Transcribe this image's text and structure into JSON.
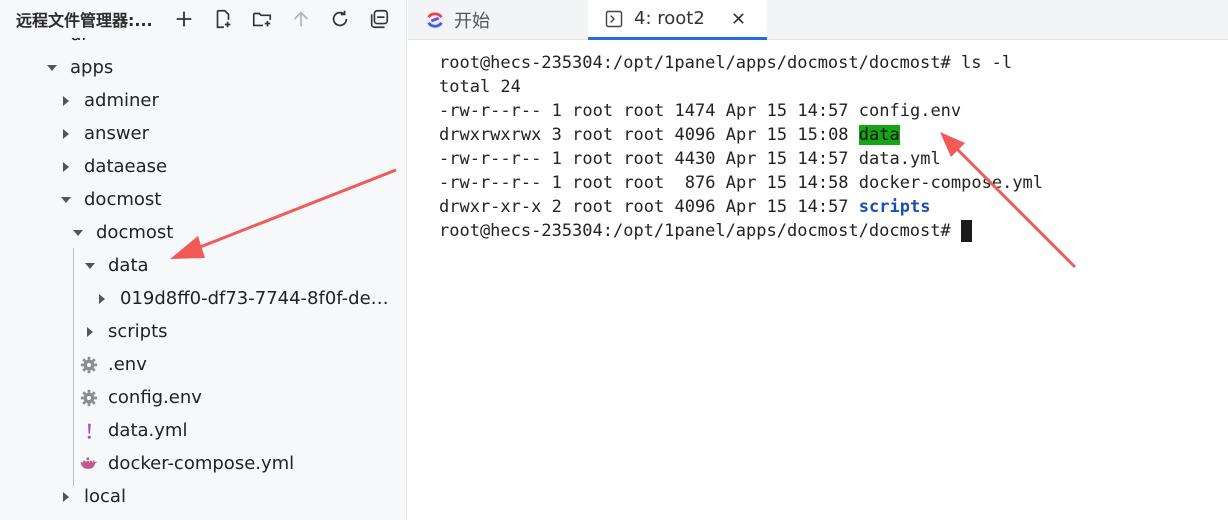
{
  "explorer": {
    "title": "远程文件管理器:...",
    "toolbar": [
      "add-icon",
      "new-file-icon",
      "new-folder-icon",
      "up-arrow-icon",
      "refresh-icon",
      "collapse-all-icon"
    ],
    "tree": [
      {
        "label": "dr",
        "depth": 1,
        "type": "folder-open"
      },
      {
        "label": "apps",
        "depth": 1,
        "type": "folder-open"
      },
      {
        "label": "adminer",
        "depth": 2,
        "type": "folder-closed"
      },
      {
        "label": "answer",
        "depth": 2,
        "type": "folder-closed"
      },
      {
        "label": "dataease",
        "depth": 2,
        "type": "folder-closed"
      },
      {
        "label": "docmost",
        "depth": 2,
        "type": "folder-open"
      },
      {
        "label": "docmost",
        "depth": 3,
        "type": "folder-open"
      },
      {
        "label": "data",
        "depth": 4,
        "type": "folder-open"
      },
      {
        "label": "019d8ff0-df73-7744-8f0f-de4...",
        "depth": 5,
        "type": "folder-closed"
      },
      {
        "label": "scripts",
        "depth": 4,
        "type": "folder-closed"
      },
      {
        "label": ".env",
        "depth": 4,
        "type": "file-gear"
      },
      {
        "label": "config.env",
        "depth": 4,
        "type": "file-gear"
      },
      {
        "label": "data.yml",
        "depth": 4,
        "type": "file-yml"
      },
      {
        "label": "docker-compose.yml",
        "depth": 4,
        "type": "file-docker"
      },
      {
        "label": "local",
        "depth": 2,
        "type": "folder-closed"
      }
    ]
  },
  "tabs": {
    "start_label": "开始",
    "terminal_label": "4: root2",
    "close_glyph": "✕"
  },
  "terminal": {
    "prompt_cmd": "root@hecs-235304:/opt/1panel/apps/docmost/docmost# ls -l",
    "total": "total 24",
    "rows": [
      {
        "perm": "-rw-r--r--",
        "links": "1",
        "owner": "root",
        "group": "root",
        "size": "1474",
        "date": "Apr 15 14:57",
        "name": "config.env",
        "style": "normal"
      },
      {
        "perm": "drwxrwxrwx",
        "links": "3",
        "owner": "root",
        "group": "root",
        "size": "4096",
        "date": "Apr 15 15:08",
        "name": "data",
        "style": "highlight"
      },
      {
        "perm": "-rw-r--r--",
        "links": "1",
        "owner": "root",
        "group": "root",
        "size": "4430",
        "date": "Apr 15 14:57",
        "name": "data.yml",
        "style": "normal"
      },
      {
        "perm": "-rw-r--r--",
        "links": "1",
        "owner": "root",
        "group": "root",
        "size": " 876",
        "date": "Apr 15 14:58",
        "name": "docker-compose.yml",
        "style": "normal"
      },
      {
        "perm": "drwxr-xr-x",
        "links": "2",
        "owner": "root",
        "group": "root",
        "size": "4096",
        "date": "Apr 15 14:57",
        "name": "scripts",
        "style": "dir"
      }
    ],
    "prompt_end": "root@hecs-235304:/opt/1panel/apps/docmost/docmost# "
  },
  "colors": {
    "annotation_arrow": "#f25a5a",
    "highlight_bg": "#14a614",
    "dir_blue": "#1c4fb3",
    "active_tab_accent": "#1e6fd9"
  }
}
